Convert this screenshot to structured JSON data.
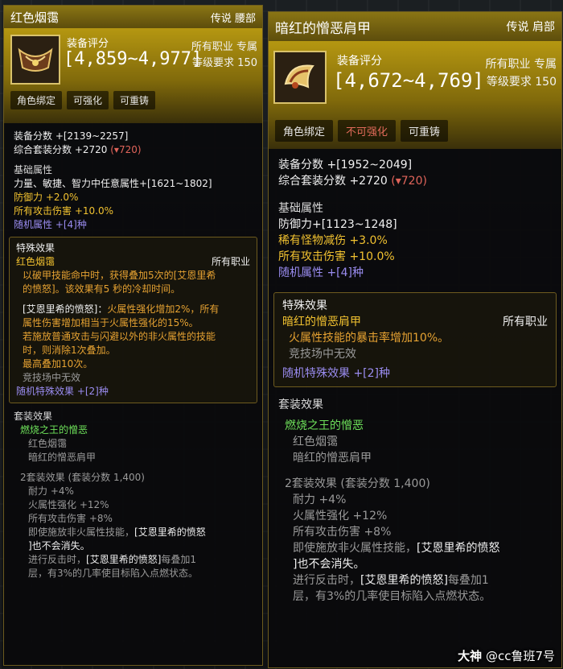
{
  "left": {
    "name": "红色烟霭",
    "grade_slot": "传说 腰部",
    "score_label": "装备评分",
    "score_range": "[4,859~4,977]",
    "class": "所有职业 专属",
    "req": "等级要求 150",
    "tags": [
      "角色绑定",
      "可强化",
      "可重铸"
    ],
    "equip_score": "装备分数 +[2139~2257]",
    "set_score": "综合套装分数 +2720",
    "set_drop": "(▾720)",
    "base_head": "基础属性",
    "base1": "力量、敏捷、智力中任意属性+[1621~1802]",
    "base2": "防御力 +2.0%",
    "base3": "所有攻击伤害 +10.0%",
    "base4": "随机属性 +[4]种",
    "special_head": "特殊效果",
    "special_name": "红色烟霭",
    "special_class": "所有职业",
    "sp1": "以破甲技能命中时，获得叠加5次的[艾恩里希",
    "sp2": "的愤怒]。该效果有5 秒的冷却时间。",
    "sp3a": "[艾恩里希的愤怒]：",
    "sp3b": "火属性强化增加2%，所有",
    "sp4": "属性伤害增加相当于火属性强化的15%。",
    "sp5": "若施放普通攻击与闪避以外的非火属性的技能",
    "sp6": "时，则消除1次叠加。",
    "sp7": "最高叠加10次。",
    "sp8": "竞技场中无效",
    "sp_random": "随机特殊效果 +[2]种",
    "set_head": "套装效果",
    "set_name": "燃烧之王的憎恶",
    "set_item1": "红色烟霭",
    "set_item2": "暗红的憎恶肩甲",
    "set2_head": "2套装效果 (套装分数 1,400)",
    "set2_1": "耐力 +4%",
    "set2_2": "火属性强化 +12%",
    "set2_3": "所有攻击伤害 +8%",
    "set2_4a": "即使施放非火属性技能，",
    "set2_4b": "[艾恩里希的愤怒",
    "set2_5": "]也不会消失。",
    "set2_6a": "进行反击时，",
    "set2_6b": "[艾恩里希的愤怒]",
    "set2_6c": "每叠加1",
    "set2_7": "层，有3%的几率使目标陷入点燃状态。"
  },
  "right": {
    "name": "暗红的憎恶肩甲",
    "grade_slot": "传说 肩部",
    "score_label": "装备评分",
    "score_range": "[4,672~4,769]",
    "class": "所有职业 专属",
    "req": "等级要求 150",
    "tags": [
      "角色绑定",
      "不可强化",
      "可重铸"
    ],
    "equip_score": "装备分数 +[1952~2049]",
    "set_score": "综合套装分数 +2720",
    "set_drop": "(▾720)",
    "base_head": "基础属性",
    "base1": "防御力+[1123~1248]",
    "base2": "稀有怪物减伤 +3.0%",
    "base3": "所有攻击伤害 +10.0%",
    "base4": "随机属性 +[4]种",
    "special_head": "特殊效果",
    "special_name": "暗红的憎恶肩甲",
    "special_class": "所有职业",
    "sp1": "火属性技能的暴击率增加10%。",
    "sp2": "竞技场中无效",
    "sp_random": "随机特殊效果 +[2]种",
    "set_head": "套装效果",
    "set_name": "燃烧之王的憎恶",
    "set_item1": "红色烟霭",
    "set_item2": "暗红的憎恶肩甲",
    "set2_head": "2套装效果 (套装分数 1,400)",
    "set2_1": "耐力 +4%",
    "set2_2": "火属性强化 +12%",
    "set2_3": "所有攻击伤害 +8%",
    "set2_4a": "即使施放非火属性技能，",
    "set2_4b": "[艾恩里希的愤怒",
    "set2_5": "]也不会消失。",
    "set2_6a": "进行反击时，",
    "set2_6b": "[艾恩里希的愤怒]",
    "set2_6c": "每叠加1",
    "set2_7": "层，有3%的几率使目标陷入点燃状态。"
  },
  "watermark": {
    "brand": "大神",
    "handle": "@cc鲁班7号"
  },
  "colors": {
    "legendary_gold": "#b59711",
    "yellow_stat": "#f2c230",
    "purple_random": "#9a8cf0",
    "set_green": "#6ee15a",
    "red_drop": "#e0645a"
  },
  "icons": {
    "left": "belt-icon",
    "right": "shoulder-armor-icon"
  }
}
